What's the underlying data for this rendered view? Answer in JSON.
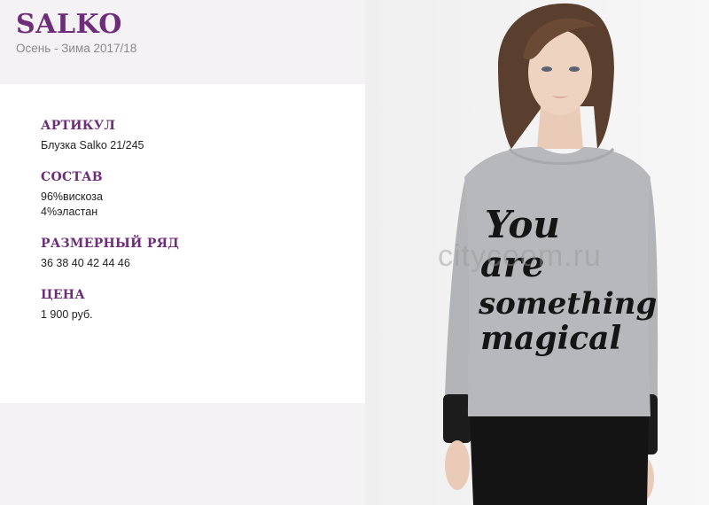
{
  "header": {
    "brand": "SALKO",
    "season": "Осень - Зима 2017/18"
  },
  "details": {
    "article_heading": "АРТИКУЛ",
    "article_value": "Блузка Salko 21/245",
    "composition_heading": "СОСТАВ",
    "composition_lines": [
      "96%вискоза",
      "4%эластан"
    ],
    "sizes_heading": "РАЗМЕРНЫЙ РЯД",
    "sizes_value": "36 38 40 42 44 46",
    "price_heading": "ЦЕНА",
    "price_value": "1 900 руб."
  },
  "photo": {
    "print_lines": [
      "You",
      "are",
      "something",
      "magical"
    ],
    "watermark": "citycoom.ru"
  },
  "colors": {
    "brand": "#6d2d79",
    "panel_bg": "#f5f2f5",
    "sweater": "#b7b8bb"
  }
}
